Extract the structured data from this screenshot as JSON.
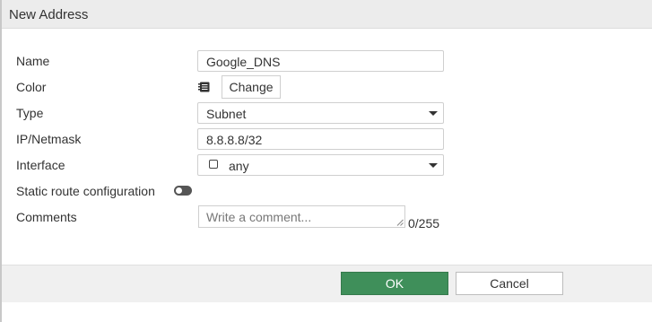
{
  "dialog": {
    "title": "New Address"
  },
  "form": {
    "name": {
      "label": "Name",
      "value": "Google_DNS"
    },
    "color": {
      "label": "Color",
      "icon": "color-swatch-icon",
      "button_label": "Change"
    },
    "type": {
      "label": "Type",
      "value": "Subnet"
    },
    "ip_netmask": {
      "label": "IP/Netmask",
      "value": "8.8.8.8/32"
    },
    "interface": {
      "label": "Interface",
      "value": "any",
      "icon": "interface-checkbox-icon"
    },
    "static_route": {
      "label": "Static route configuration",
      "enabled": false
    },
    "comments": {
      "label": "Comments",
      "placeholder": "Write a comment...",
      "counter": "0/255"
    }
  },
  "footer": {
    "ok_label": "OK",
    "cancel_label": "Cancel"
  },
  "colors": {
    "ok_button": "#3f8f5a",
    "titlebar": "#ececec",
    "footer": "#f0f0f0"
  }
}
